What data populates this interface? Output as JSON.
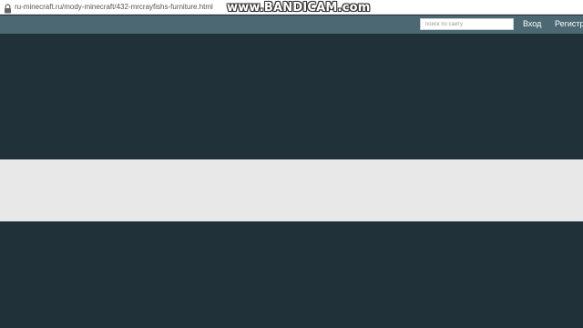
{
  "browser": {
    "url": "ru-minecraft.ru/mody-minecraft/432-mrcrayfishs-furniture.html",
    "lock_icon": "lock-icon"
  },
  "watermark": {
    "text": "www.BANDICAM.com"
  },
  "header": {
    "search_placeholder": "поиск по сайту",
    "login_label": "Вход",
    "register_label": "Регистр"
  },
  "colors": {
    "header_bg": "#4b6873",
    "page_bg": "#20313a",
    "band_bg": "#e8e8e8"
  }
}
